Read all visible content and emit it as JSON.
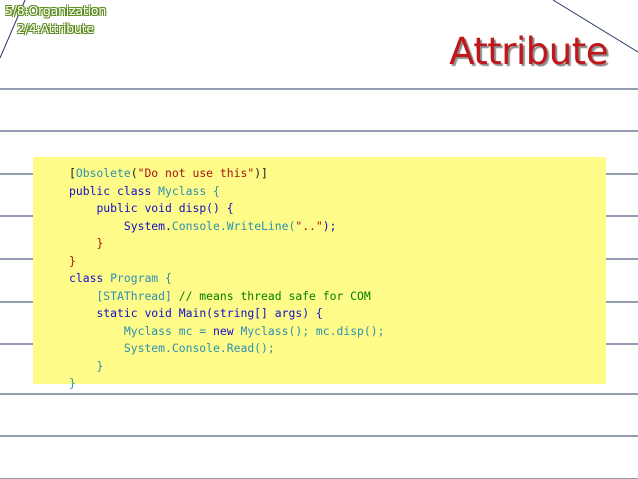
{
  "breadcrumb": {
    "section": "5/8:Organization",
    "subsection": "2/4:Attribute"
  },
  "title": "Attribute",
  "code": {
    "line1": {
      "open": "[",
      "type": "Obsolete",
      "paren_open": "(",
      "string": "\"Do not use this\"",
      "close": ")]"
    },
    "line2": {
      "kw1": "public",
      "kw2": "class",
      "name": "Myclass",
      "brace": "{"
    },
    "line3": {
      "kw1": "public",
      "kw2": "void",
      "name": "disp()",
      "brace": "{"
    },
    "line4": {
      "ns": "System",
      "dot1": ".",
      "cls": "Console",
      "method": ".WriteLine(",
      "string": "\"..\"",
      "end": ");"
    },
    "line5": {
      "brace": "}"
    },
    "line6": {
      "brace": "}"
    },
    "line7": {
      "kw": "class",
      "name": "Program",
      "brace": "{"
    },
    "line8": {
      "attr": "[STAThread]",
      "comment": "// means thread safe for COM"
    },
    "line9": {
      "kw1": "static",
      "kw2": "void",
      "name": "Main(string[] args)",
      "brace": "{"
    },
    "line10": {
      "decl": "Myclass mc =",
      "kw": "new",
      "ctor": "Myclass(); mc.disp();"
    },
    "line11": {
      "text": "System.Console.Read();"
    },
    "line12": {
      "brace": "}"
    },
    "line13": {
      "brace": "}"
    }
  },
  "colors": {
    "title": "#c0171b",
    "breadcrumb_outline": "#5a8a1a",
    "code_background": "#fffb88",
    "keyword": "#0f0fc8",
    "type": "#2b91af",
    "string": "#a31515",
    "comment": "#008000",
    "rule_lines": "#2b3a66"
  }
}
